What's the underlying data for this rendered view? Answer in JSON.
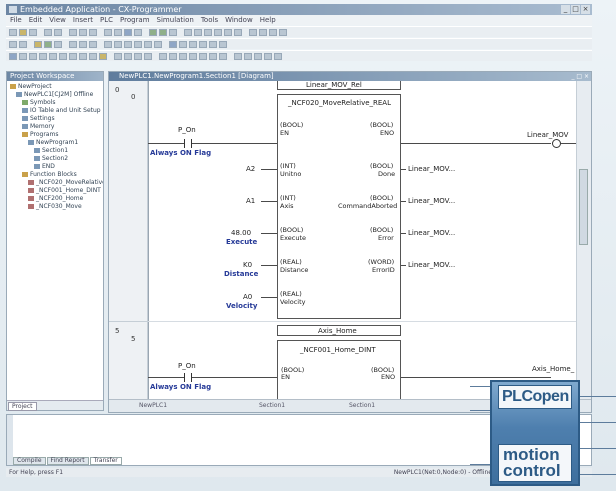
{
  "window": {
    "title": "Embedded Application - CX-Programmer",
    "controls": [
      "_",
      "□",
      "×"
    ]
  },
  "menubar": [
    "File",
    "Edit",
    "View",
    "Insert",
    "PLC",
    "Program",
    "Simulation",
    "Tools",
    "Window",
    "Help"
  ],
  "project": {
    "title": "Project Workspace",
    "tree": [
      {
        "label": "NewProject",
        "indent": 0,
        "icon": "o"
      },
      {
        "label": "NewPLC1[CJ2M] Offline",
        "indent": 1,
        "icon": "b"
      },
      {
        "label": "Symbols",
        "indent": 2,
        "icon": "g"
      },
      {
        "label": "IO Table and Unit Setup",
        "indent": 2,
        "icon": "b"
      },
      {
        "label": "Settings",
        "indent": 2,
        "icon": "b"
      },
      {
        "label": "Memory",
        "indent": 2,
        "icon": "b"
      },
      {
        "label": "Programs",
        "indent": 2,
        "icon": "o"
      },
      {
        "label": "NewProgram1",
        "indent": 3,
        "icon": "b"
      },
      {
        "label": "Section1",
        "indent": 4,
        "icon": "b"
      },
      {
        "label": "Section2",
        "indent": 4,
        "icon": "b"
      },
      {
        "label": "END",
        "indent": 4,
        "icon": "b"
      },
      {
        "label": "Function Blocks",
        "indent": 2,
        "icon": "o"
      },
      {
        "label": "_NCF020_MoveRelative",
        "indent": 3,
        "icon": "r"
      },
      {
        "label": "_NCF001_Home_DINT",
        "indent": 3,
        "icon": "r"
      },
      {
        "label": "_NCF200_Home",
        "indent": 3,
        "icon": "r"
      },
      {
        "label": "_NCF030_Move",
        "indent": 3,
        "icon": "r"
      }
    ],
    "tab": "Project"
  },
  "editor": {
    "title": "NewPLC1.NewProgram1.Section1 [Diagram]",
    "rows": [
      {
        "num": "0",
        "sub": "0"
      },
      {
        "num": "5",
        "sub": "5"
      }
    ],
    "rung1": {
      "instance": "Linear_MOV_Rel",
      "fb_name": "_NCF020_MoveRelative_REAL",
      "contact": "P_On",
      "contact_comment": "Always ON Flag",
      "coil": "Linear_MOV",
      "inputs": [
        {
          "type": "(BOOL)",
          "name": "EN",
          "arg": ""
        },
        {
          "type": "(INT)",
          "name": "Unitno",
          "arg": "A2"
        },
        {
          "type": "(INT)",
          "name": "Axis",
          "arg": "A1"
        },
        {
          "type": "(BOOL)",
          "name": "Execute",
          "arg": "48.00",
          "argLabel": "Execute"
        },
        {
          "type": "(REAL)",
          "name": "Distance",
          "arg": "K0",
          "argLabel": "Distance"
        },
        {
          "type": "(REAL)",
          "name": "Velocity",
          "arg": "A0",
          "argLabel": "Velocity"
        }
      ],
      "outputs": [
        {
          "type": "(BOOL)",
          "name": "ENO",
          "arg": ""
        },
        {
          "type": "(BOOL)",
          "name": "Done",
          "arg": "Linear_MOV..."
        },
        {
          "type": "(BOOL)",
          "name": "CommandAborted",
          "arg": "Linear_MOV..."
        },
        {
          "type": "(BOOL)",
          "name": "Error",
          "arg": "Linear_MOV..."
        },
        {
          "type": "(WORD)",
          "name": "ErrorID",
          "arg": "Linear_MOV..."
        }
      ]
    },
    "rung2": {
      "instance": "Axis_Home",
      "fb_name": "_NCF001_Home_DINT",
      "contact": "P_On",
      "contact_comment": "Always ON Flag",
      "coil": "Axis_Home_",
      "inputs": [
        {
          "type": "(BOOL)",
          "name": "EN"
        }
      ],
      "outputs": [
        {
          "type": "(BOOL)",
          "name": "ENO"
        }
      ]
    },
    "hscroll": [
      "NewPLC1",
      "Section1",
      "Section1"
    ]
  },
  "bottom": {
    "tabs": [
      "Compile",
      "Find Report",
      "Transfer"
    ],
    "active_tab": "Transfer"
  },
  "status": {
    "left": "For Help, press F1",
    "right": "NewPLC1(Net:0,Node:0) - Offline"
  },
  "logo": {
    "brand": "PLCopen",
    "line1": "motion",
    "line2": "control",
    "color": "#2d5b86"
  },
  "colors": {
    "titlebar": "#6c86a4",
    "comment_blue": "#263a98"
  }
}
